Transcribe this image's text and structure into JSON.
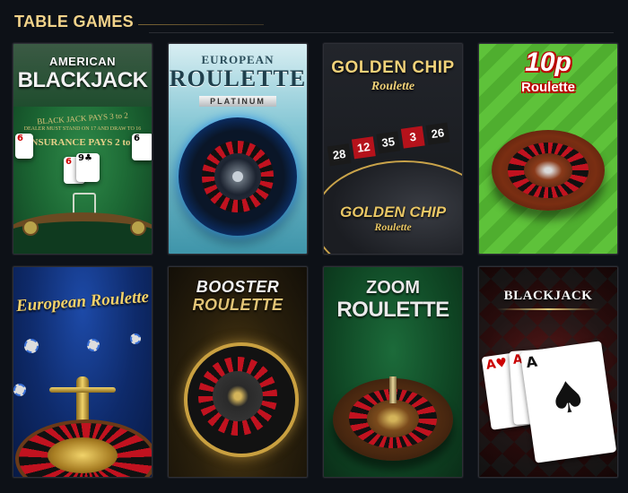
{
  "section": {
    "title": "TABLE GAMES"
  },
  "games": [
    {
      "title_line1": "AMERICAN",
      "title_line2": "BLACKJACK",
      "felt_text": "BLACK JACK PAYS 3 to 2",
      "felt_text2": "DEALER MUST STAND ON 17 AND DRAW TO 16",
      "felt_text3": "INSURANCE PAYS 2 to 1"
    },
    {
      "title_line1": "EUROPEAN",
      "title_line2": "ROULETTE",
      "badge": "PLATINUM"
    },
    {
      "title_line1": "GOLDEN CHIP",
      "title_line2": "Roulette",
      "numbers": [
        "28",
        "12",
        "35",
        "3",
        "26"
      ],
      "logo_line1": "GOLDEN CHIP",
      "logo_line2": "Roulette"
    },
    {
      "title_line1": "10p",
      "title_line2": "Roulette"
    },
    {
      "title_line1": "European Roulette"
    },
    {
      "title_line1": "BOOSTER",
      "title_line2": "ROULETTE"
    },
    {
      "title_line1": "ZOOM",
      "title_line2": "ROULETTE"
    },
    {
      "title_line1": "BLACKJACK"
    }
  ]
}
